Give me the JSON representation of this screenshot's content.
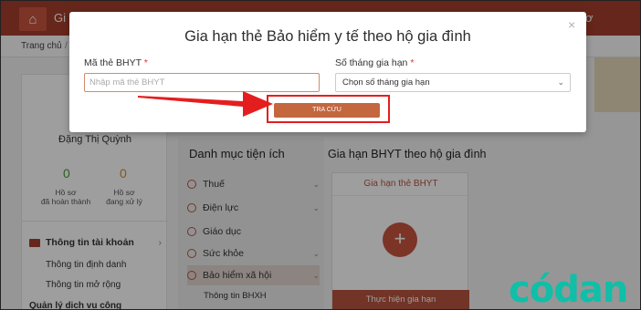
{
  "topbar": {
    "title": "Gi",
    "right_text": "ơ",
    "home_icon": "home-icon"
  },
  "breadcrumb": {
    "home": "Trang chủ",
    "separator": "/"
  },
  "profile": {
    "name": "Đặng Thị Quỳnh",
    "stats": [
      {
        "value": "0",
        "label_line1": "Hồ sơ",
        "label_line2": "đã hoàn thành"
      },
      {
        "value": "0",
        "label_line1": "Hồ sơ",
        "label_line2": "đang xử lý"
      }
    ]
  },
  "account_menu": {
    "title": "Thông tin tài khoản",
    "items": [
      "Thông tin định danh",
      "Thông tin mở rộng"
    ],
    "next_partial": "Quản lý dịch vụ công"
  },
  "utility_catalog": {
    "title": "Danh mục tiện ích",
    "items": [
      {
        "label": "Thuế"
      },
      {
        "label": "Điện lực"
      },
      {
        "label": "Giáo dục"
      },
      {
        "label": "Sức khỏe"
      },
      {
        "label": "Bảo hiểm xã hội"
      }
    ],
    "sub_item": "Thông tin BHXH"
  },
  "renew_section": {
    "title": "Gia hạn BHYT theo hộ gia đình",
    "card_header": "Gia hạn thẻ BHYT",
    "card_action": "Thực hiện gia hạn"
  },
  "modal": {
    "title": "Gia hạn thẻ Bảo hiểm y tế theo hộ gia đình",
    "close_glyph": "×",
    "card_field": {
      "label": "Mã thẻ BHYT",
      "required_mark": "*",
      "value": "",
      "placeholder": "Nhập mã thẻ BHYT"
    },
    "months_field": {
      "label": "Số tháng gia hạn",
      "required_mark": "*",
      "selected": "Chọn số tháng gia hạn"
    },
    "search_button": "TRA CỨU"
  },
  "watermark": {
    "text": "códan"
  },
  "colors": {
    "brand": "#a73e2c",
    "button": "#c4673f",
    "highlight": "#e41e1e",
    "watermark": "#0fbfa8"
  }
}
